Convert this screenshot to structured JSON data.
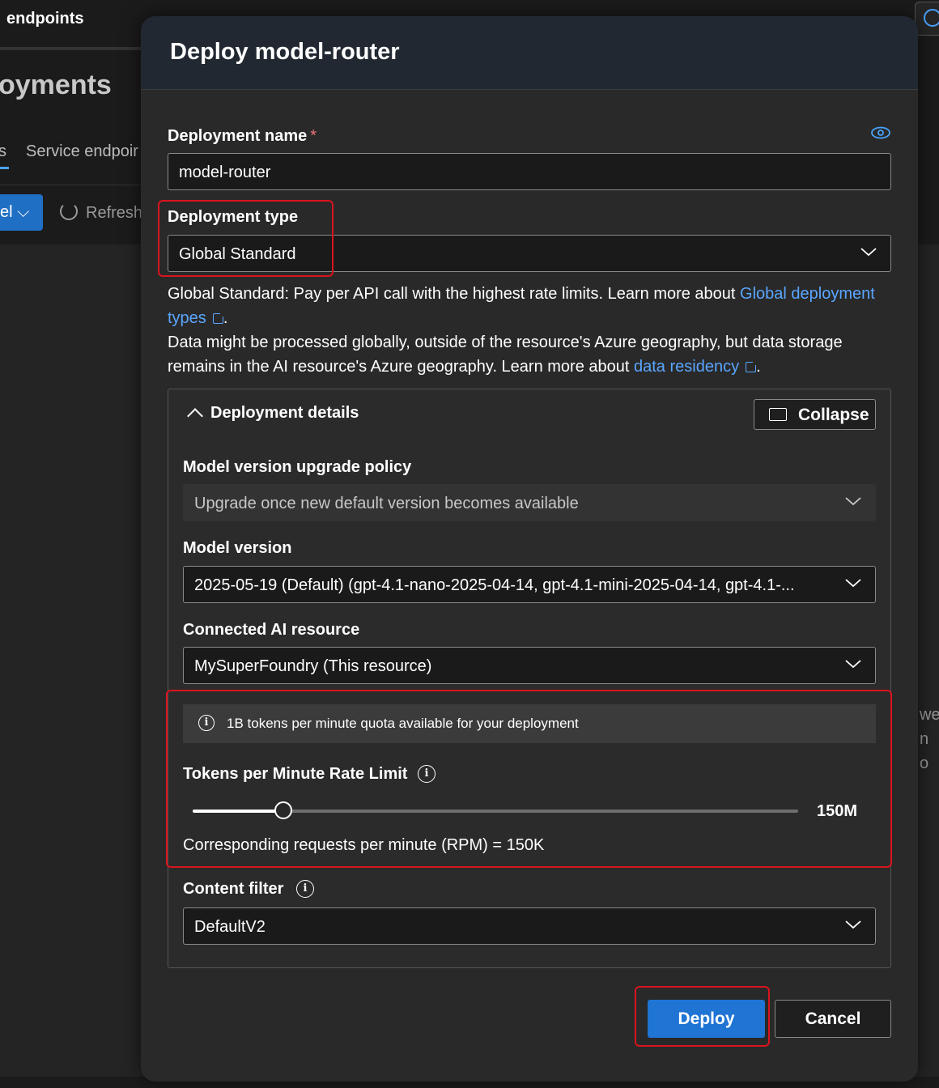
{
  "background": {
    "breadcrumb": "endpoints",
    "page_title": "oyments",
    "tab_partial": "s",
    "tab_service": "Service endpoir",
    "deploy_btn_partial": "el ⌵",
    "refresh_label": "Refresh",
    "right_partial_line1": "we",
    "right_partial_line2": "n o"
  },
  "dialog": {
    "title": "Deploy model-router",
    "deployment_name": {
      "label": "Deployment name",
      "required_mark": "*",
      "value": "model-router"
    },
    "deployment_type": {
      "label": "Deployment type",
      "value": "Global Standard"
    },
    "description": {
      "text1": "Global Standard: Pay per API call with the highest rate limits. Learn more about ",
      "link1": "Global deployment types",
      "text2": ".",
      "text3": "Data might be processed globally, outside of the resource's Azure geography, but data storage remains in the AI resource's Azure geography. Learn more about ",
      "link2": "data residency",
      "text4": "."
    },
    "details": {
      "title": "Deployment details",
      "collapse_label": "Collapse",
      "upgrade_policy": {
        "label": "Model version upgrade policy",
        "value": "Upgrade once new default version becomes available"
      },
      "model_version": {
        "label": "Model version",
        "value": "2025-05-19 (Default) (gpt-4.1-nano-2025-04-14, gpt-4.1-mini-2025-04-14, gpt-4.1-..."
      },
      "connected_resource": {
        "label": "Connected AI resource",
        "value": "MySuperFoundry (This resource)"
      },
      "quota_info": "1B tokens per minute quota available for your deployment",
      "rate_limit": {
        "label": "Tokens per Minute Rate Limit",
        "value_label": "150M",
        "fraction": 0.15
      },
      "rpm_text": "Corresponding requests per minute (RPM) = 150K",
      "content_filter": {
        "label": "Content filter",
        "value": "DefaultV2"
      }
    },
    "buttons": {
      "deploy": "Deploy",
      "cancel": "Cancel"
    }
  },
  "colors": {
    "accent": "#1f74d4",
    "link": "#5aa6ff",
    "highlight": "#d9141d"
  }
}
